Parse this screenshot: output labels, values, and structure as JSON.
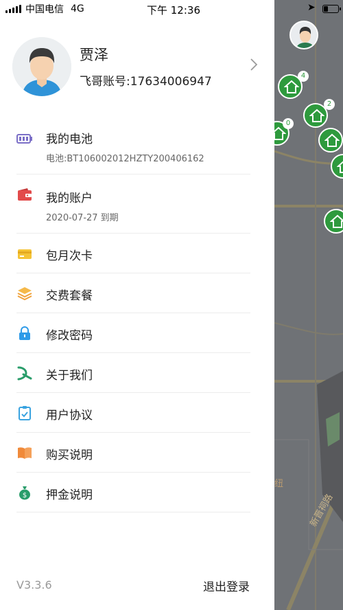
{
  "status_bar": {
    "carrier": "中国电信",
    "network": "4G",
    "time": "下午 12:36"
  },
  "profile": {
    "name": "贾泽",
    "account": "飞哥账号:17634006947"
  },
  "menu": {
    "battery": {
      "label": "我的电池",
      "sub": "电池:BT106002012HZTY200406162"
    },
    "account": {
      "label": "我的账户",
      "sub": "2020-07-27 到期"
    },
    "monthly_card": {
      "label": "包月次卡"
    },
    "packages": {
      "label": "交费套餐"
    },
    "change_password": {
      "label": "修改密码"
    },
    "about": {
      "label": "关于我们"
    },
    "user_agreement": {
      "label": "用户协议"
    },
    "purchase_info": {
      "label": "购买说明"
    },
    "deposit_info": {
      "label": "押金说明"
    }
  },
  "footer": {
    "version": "V3.3.6",
    "logout": "退出登录"
  },
  "map": {
    "pin_badges": [
      "4",
      "2",
      "0"
    ],
    "road_label": "新晋祠路",
    "fragment_label": "纽"
  },
  "colors": {
    "pin_green": "#2e9a3d",
    "battery_purple": "#7b6fc7",
    "wallet_red": "#e24b4b",
    "card_yellow": "#f5c437",
    "stack_orange": "#f0a23c",
    "lock_blue": "#2f9be8",
    "about_green": "#2a9d6b",
    "agreement_blue": "#3aa3e0",
    "book_orange": "#f08a3a",
    "money_green": "#2a9d6b"
  }
}
